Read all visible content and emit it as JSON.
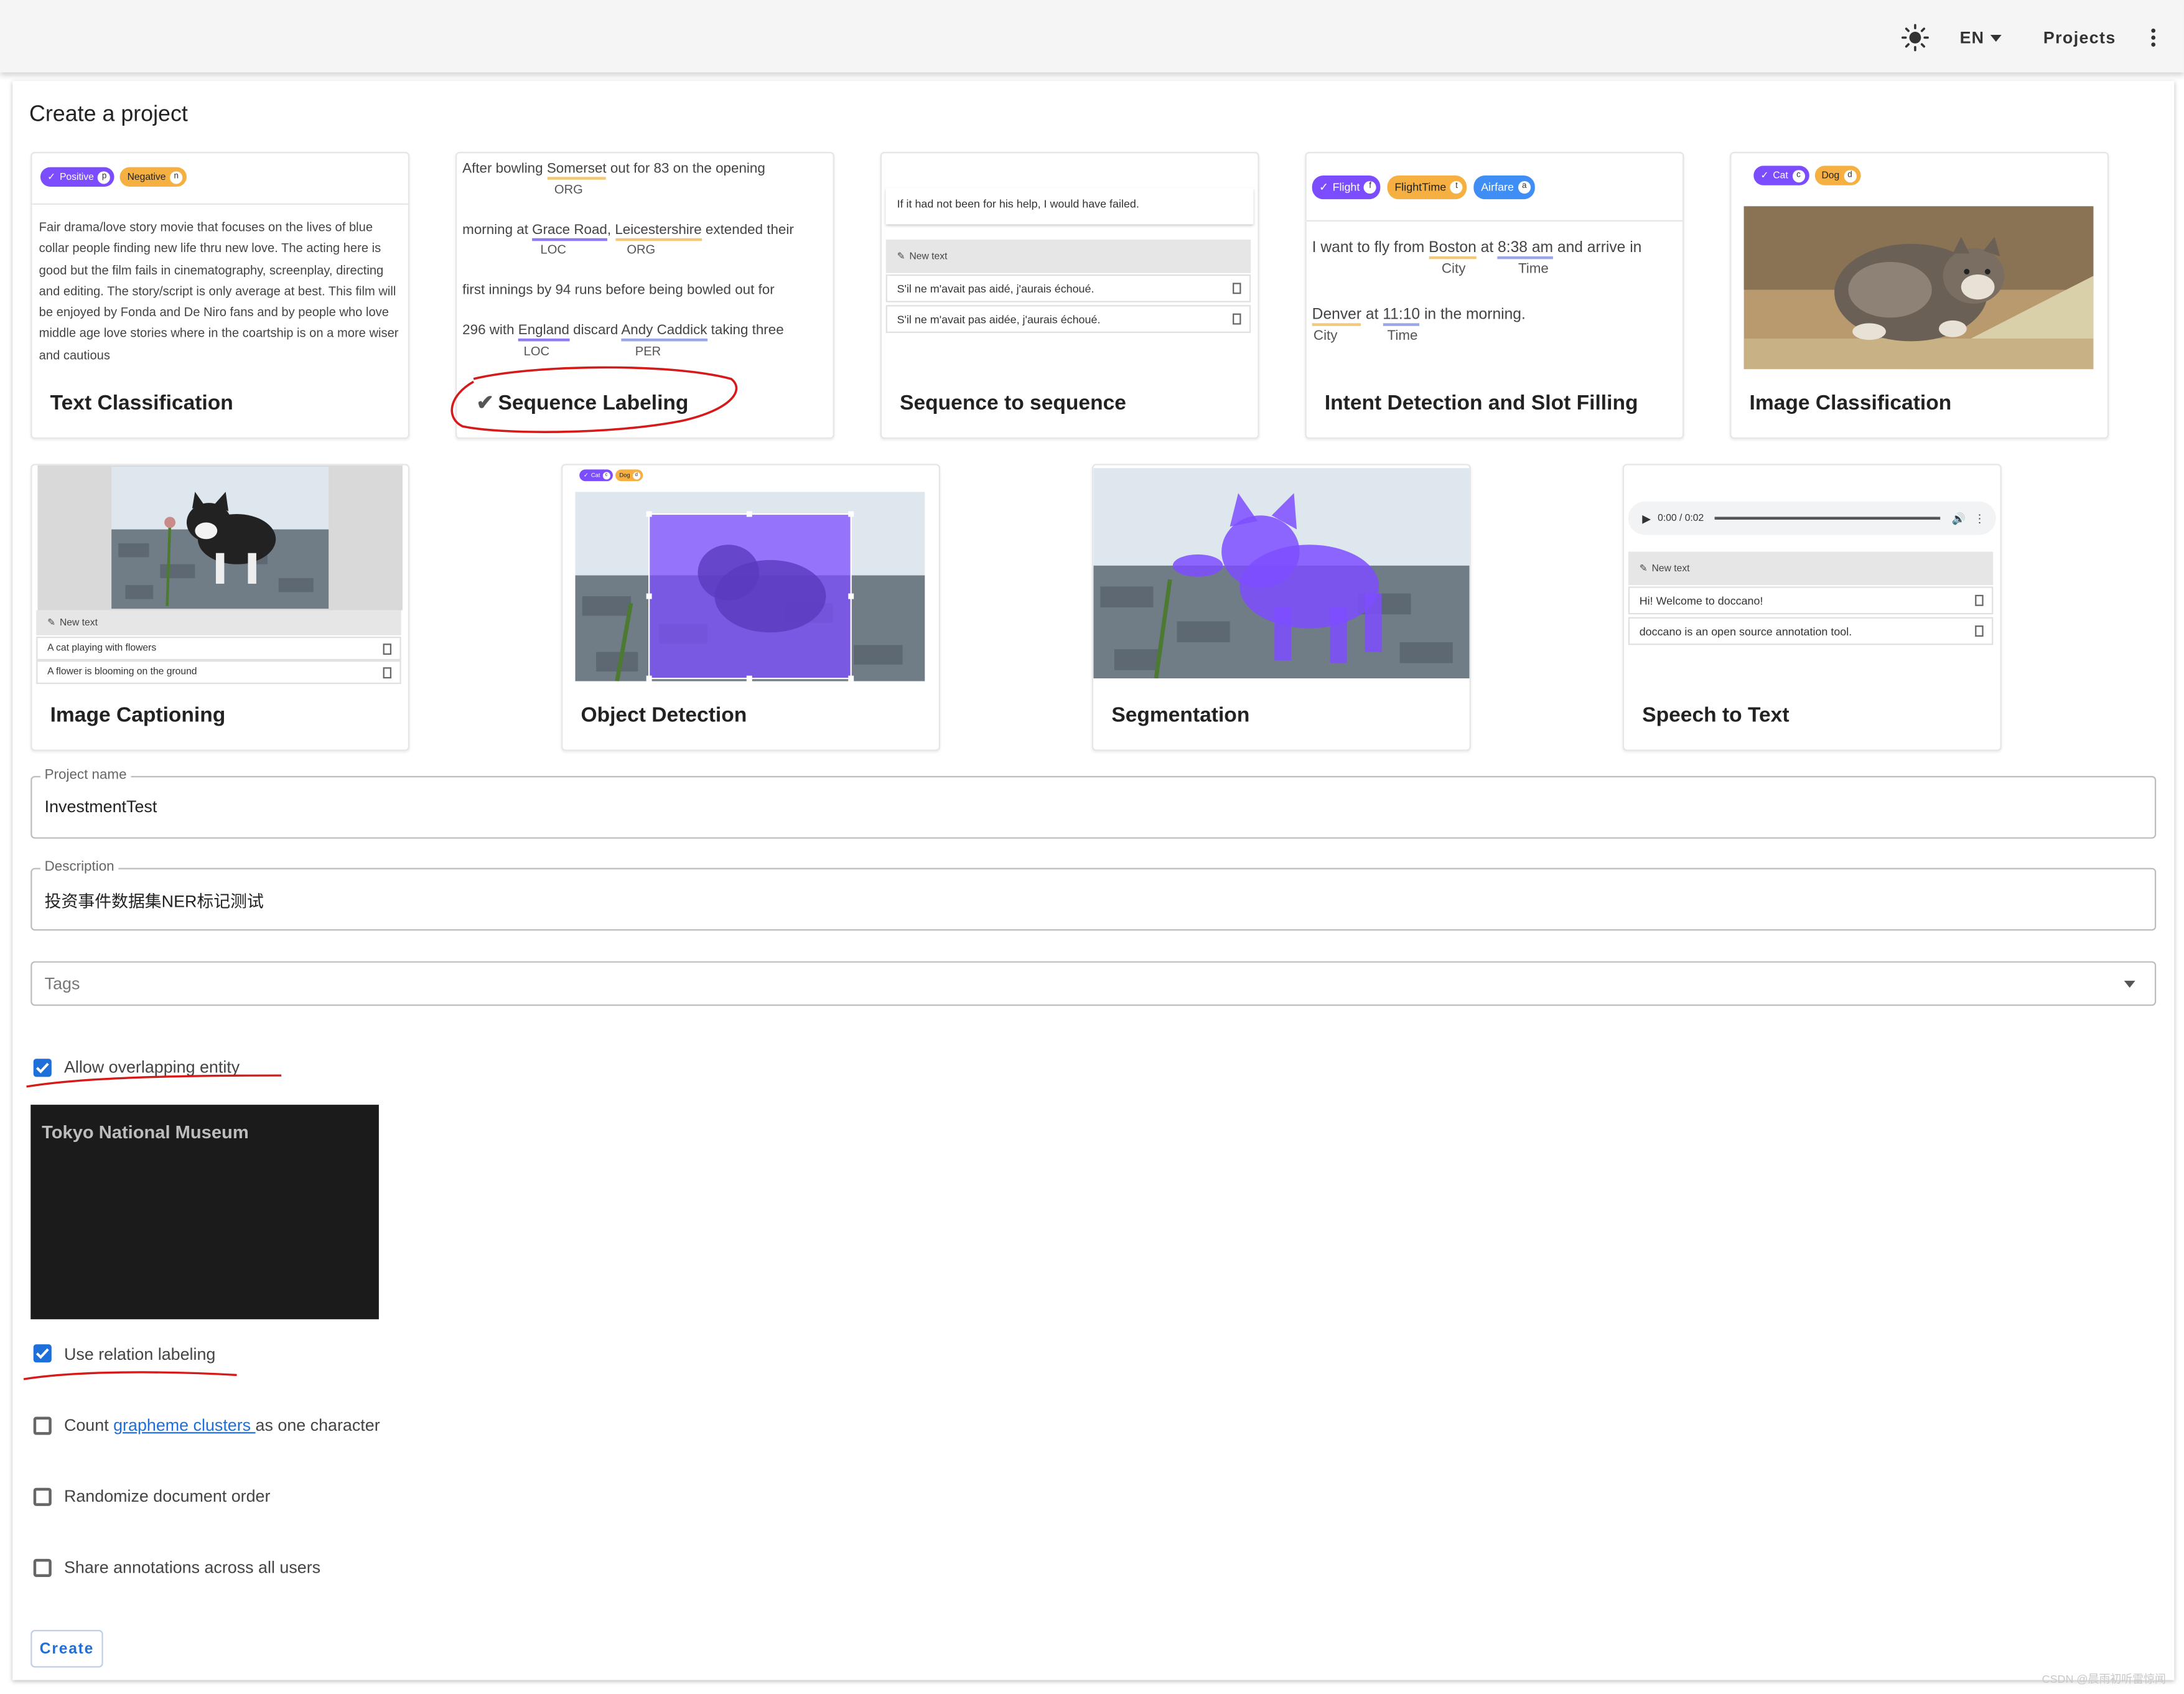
{
  "appbar": {
    "theme_icon": "sun-icon",
    "lang": "EN",
    "projects": "Projects",
    "menu_icon": "dots-vertical-icon"
  },
  "page": {
    "title": "Create a project"
  },
  "cards": {
    "text_classification": {
      "label": "Text Classification",
      "chips": [
        "Positive",
        "Negative"
      ],
      "chip_keys": [
        "p",
        "n"
      ],
      "body": "Fair drama/love story movie that focuses on the lives of blue collar people finding new life thru new love. The acting here is good but the film fails in cinematography, screenplay, directing and editing. The story/script is only average at best. This film will be enjoyed by Fonda and De Niro fans and by people who love middle age love stories where in the coartship is on a more wiser and cautious"
    },
    "sequence_labeling": {
      "label": "Sequence Labeling",
      "check": "✔",
      "l1a": "After bowling ",
      "l1b": "Somerset",
      "l1c": " out for 83 on the opening",
      "l2a": "morning at ",
      "l2b": "Grace Road",
      "l2c": ", ",
      "l2d": "Leicestershire",
      "l2e": " extended their",
      "l3": "first innings by 94 runs before being bowled out for",
      "l4a": "296 with ",
      "l4b": "England",
      "l4c": " discard ",
      "l4d": "Andy Caddick",
      "l4e": " taking three",
      "tags": [
        "ORG",
        "LOC",
        "ORG",
        "LOC",
        "PER"
      ]
    },
    "seq2seq": {
      "label": "Sequence to sequence",
      "source": "If it had not been for his help, I would have failed.",
      "new_text": "New text",
      "rows": [
        "S'il ne m'avait pas aidé, j'aurais échoué.",
        "S'il ne m'avait pas aidée, j'aurais échoué."
      ]
    },
    "intent": {
      "label": "Intent Detection and Slot Filling",
      "chips": [
        "Flight",
        "FlightTime",
        "Airfare"
      ],
      "chip_keys": [
        "f",
        "t",
        "a"
      ],
      "l1a": "I want to fly from ",
      "l1b": "Boston",
      "l1c": " at ",
      "l1d": "8:38 am",
      "l1e": " and arrive in",
      "l2a": "Denver",
      "l2b": " at ",
      "l2c": "11:10",
      "l2d": " in the morning.",
      "tags": [
        "City",
        "Time",
        "City",
        "Time"
      ]
    },
    "image_classification": {
      "label": "Image Classification",
      "chips": [
        "Cat",
        "Dog"
      ],
      "chip_keys": [
        "c",
        "d"
      ]
    },
    "image_captioning": {
      "label": "Image Captioning",
      "new_text": "New text",
      "rows": [
        "A cat playing with flowers",
        "A flower is blooming on the ground"
      ]
    },
    "object_detection": {
      "label": "Object Detection",
      "chips": [
        "Cat",
        "Dog"
      ],
      "chip_keys": [
        "c",
        "d"
      ]
    },
    "segmentation": {
      "label": "Segmentation"
    },
    "speech": {
      "label": "Speech to Text",
      "time": "0:00 / 0:02",
      "new_text": "New text",
      "rows": [
        "Hi! Welcome to doccano!",
        "doccano is an open source annotation tool."
      ]
    }
  },
  "form": {
    "project_name_label": "Project name",
    "project_name": "InvestmentTest",
    "description_label": "Description",
    "description": "投资事件数据集NER标记测试",
    "tags_placeholder": "Tags",
    "allow_overlap": "Allow overlapping entity",
    "tooltip_text": "Tokyo National Museum",
    "use_relation": "Use relation labeling",
    "count_pre": "Count ",
    "count_link": "grapheme clusters ",
    "count_post": "as one character",
    "randomize": "Randomize document order",
    "share": "Share annotations across all users",
    "create": "Create",
    "checkbox_states": {
      "allow_overlap": true,
      "use_relation": true,
      "count_grapheme": false,
      "randomize": false,
      "share": false
    }
  },
  "watermark": "CSDN @晨雨初听雷惊闻",
  "colors": {
    "accent": "#1e6fd9",
    "purple": "#7c4dff",
    "orange": "#f5b041",
    "annotation_red": "#d61a1a"
  }
}
